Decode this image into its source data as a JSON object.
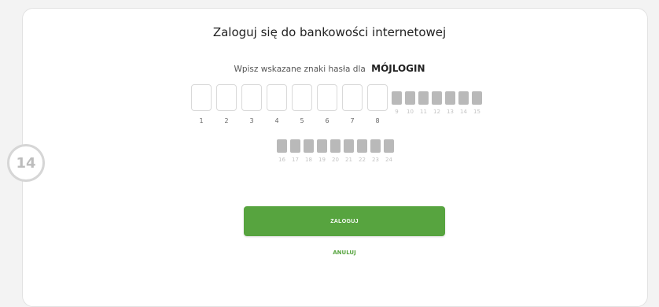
{
  "step": {
    "number": "14"
  },
  "login": {
    "title": "Zaloguj się do bankowości internetowej",
    "instruction": "Wpisz wskazane znaki hasła dla",
    "username": "MÓJLOGIN",
    "active_positions": [
      "1",
      "2",
      "3",
      "4",
      "5",
      "6",
      "7",
      "8"
    ],
    "disabled_positions_row1": [
      "9",
      "10",
      "11",
      "12",
      "13",
      "14",
      "15"
    ],
    "disabled_positions_row2": [
      "16",
      "17",
      "18",
      "19",
      "20",
      "21",
      "22",
      "23",
      "24"
    ],
    "login_label": "ZALOGUJ",
    "cancel_label": "ANULUJ"
  },
  "colors": {
    "accent": "#57a43f",
    "disabled": "#b9b9b9"
  }
}
